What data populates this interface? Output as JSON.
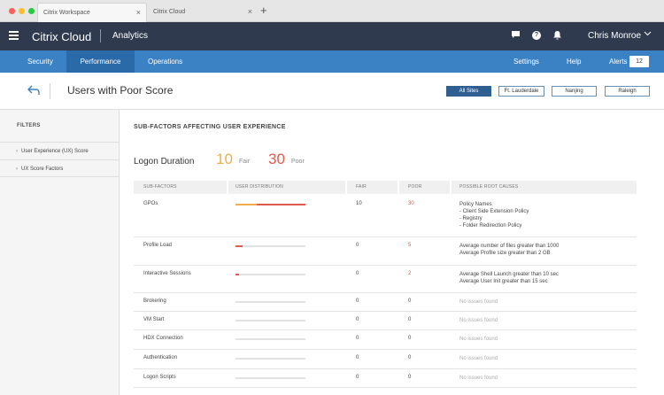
{
  "browser": {
    "tabs": [
      {
        "label": "Citrix Workspace",
        "close": "×"
      },
      {
        "label": "Citrix Cloud",
        "close": "×"
      }
    ],
    "new_tab": "+"
  },
  "header": {
    "brand": "Citrix Cloud",
    "section": "Analytics",
    "user": "Chris Monroe",
    "help_glyph": "?"
  },
  "nav": {
    "left": [
      "Security",
      "Performance",
      "Operations"
    ],
    "settings": "Settings",
    "help": "Help",
    "alerts": "Alerts",
    "alerts_count": "12"
  },
  "page": {
    "title": "Users with Poor Score",
    "sites": [
      "All Sites",
      "Ft. Lauderdale",
      "Nanjing",
      "Raleigh"
    ],
    "selected_site": "All Sites"
  },
  "sidebar": {
    "header": "FILTERS",
    "items": [
      "User Experience (UX) Score",
      "UX Score Factors"
    ]
  },
  "main": {
    "section_header": "SUB-FACTORS AFFECTING USER EXPERIENCE",
    "factor_title": "Logon Duration",
    "fair_count": "10",
    "fair_label": "Fair",
    "poor_count": "30",
    "poor_label": "Poor",
    "columns": [
      "SUB-FACTORS",
      "USER DISTRIBUTION",
      "FAIR",
      "POOR",
      "POSSIBLE ROOT CAUSES"
    ],
    "rows": [
      {
        "name": "GPOs",
        "fair": "10",
        "poor": "30",
        "distribution": {
          "fair_pct": 0.3,
          "poor_pct": 0.7
        },
        "causes": [
          "Policy Names",
          "- Client Side Extension Policy",
          "- Registry",
          "- Folder Redirection Policy"
        ]
      },
      {
        "name": "Profile Load",
        "fair": "0",
        "poor": "5",
        "distribution": {
          "fair_pct": 0.0,
          "poor_pct": 0.1
        },
        "causes": [
          "Average number of files greater than 1000",
          "Average Profile size greater than 2 GB"
        ]
      },
      {
        "name": "Interactive Sessions",
        "fair": "0",
        "poor": "2",
        "distribution": {
          "fair_pct": 0.0,
          "poor_pct": 0.05
        },
        "causes": [
          "Average Shell Launch greater than 10 sec",
          "Average User Init greater than 15 sec"
        ]
      },
      {
        "name": "Brokering",
        "fair": "0",
        "poor": "0",
        "distribution": {
          "fair_pct": 0.0,
          "poor_pct": 0.0
        },
        "causes": [
          "No issues found"
        ]
      },
      {
        "name": "VM Start",
        "fair": "0",
        "poor": "0",
        "distribution": {
          "fair_pct": 0.0,
          "poor_pct": 0.0
        },
        "causes": [
          "No issues found"
        ]
      },
      {
        "name": "HDX Connection",
        "fair": "0",
        "poor": "0",
        "distribution": {
          "fair_pct": 0.0,
          "poor_pct": 0.0
        },
        "causes": [
          "No issues found"
        ]
      },
      {
        "name": "Authentication",
        "fair": "0",
        "poor": "0",
        "distribution": {
          "fair_pct": 0.0,
          "poor_pct": 0.0
        },
        "causes": [
          "No issues found"
        ]
      },
      {
        "name": "Logon Scripts",
        "fair": "0",
        "poor": "0",
        "distribution": {
          "fair_pct": 0.0,
          "poor_pct": 0.0
        },
        "causes": [
          "No issues found"
        ]
      }
    ]
  },
  "colors": {
    "header_bg": "#2f3a4f",
    "nav_bg": "#3b82c4",
    "nav_active": "#2a6aa8",
    "fair": "#f0ad4e",
    "poor": "#e05a4e"
  },
  "icons": {
    "menu": "hamburger-icon",
    "chat": "chat-icon",
    "help": "help-icon",
    "bell": "bell-icon",
    "back": "back-arrow-icon",
    "chevron": "chevron-right-icon",
    "user_menu": "chevron-down-icon"
  }
}
